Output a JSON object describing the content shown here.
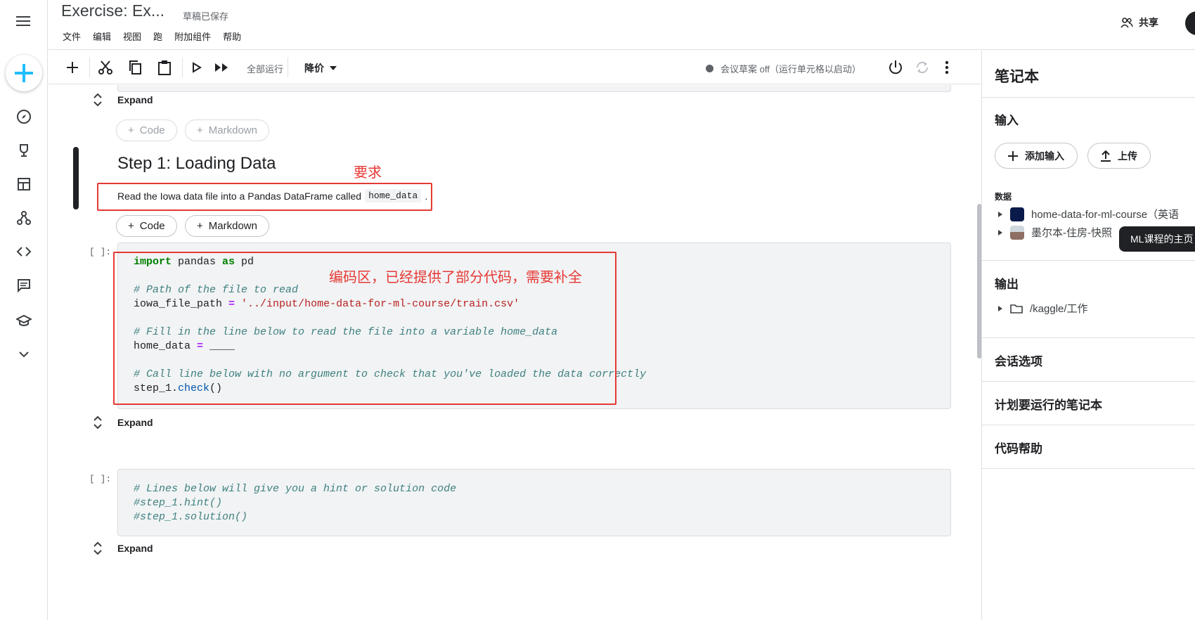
{
  "app": {
    "title": "Exercise: Ex...",
    "save_status": "草稿已保存",
    "menu": [
      "文件",
      "编辑",
      "视图",
      "跑",
      "附加组件",
      "帮助"
    ],
    "share_label": "共享"
  },
  "toolbar": {
    "run_all_label": "全部运行",
    "cell_type": "降价",
    "session_status": "会议草案 off（运行单元格以启动）"
  },
  "cells": {
    "expand_label": "Expand",
    "add_code": "Code",
    "add_markdown": "Markdown",
    "prompt": "[ ]:",
    "markdown": {
      "heading": "Step 1: Loading Data",
      "text": "Read the Iowa data file into a Pandas DataFrame called",
      "code": "home_data",
      "text_end": "."
    },
    "code1": {
      "import": "import",
      "pandas": " pandas ",
      "as": "as",
      "pd": " pd",
      "comment1": "# Path of the file to read",
      "path_var": "iowa_file_path ",
      "eq": "=",
      "path_str": " '../input/home-data-for-ml-course/train.csv'",
      "comment2": "# Fill in the line below to read the file into a variable home_data",
      "home_var": "home_data ",
      "blank": " ____",
      "comment3": "# Call line below with no argument to check that you've loaded the data correctly",
      "step": "step_1.",
      "check": "check",
      "parens": "()"
    },
    "code2": {
      "line1": "# Lines below will give you a hint or solution code",
      "line2": "#step_1.hint()",
      "line3": "#step_1.solution()"
    }
  },
  "annotations": {
    "requirement": "要求",
    "code_area": "编码区，已经提供了部分代码，需要补全"
  },
  "sidebar": {
    "title": "笔记本",
    "input_section": "输入",
    "add_input": "添加输入",
    "upload": "上传",
    "data_label": "数据",
    "data_items": [
      "home-data-for-ml-course（英语",
      "墨尔本-住房-快照"
    ],
    "output_section": "输出",
    "output_path": "/kaggle/工作",
    "session_options": "会话选项",
    "scheduled": "计划要运行的笔记本",
    "code_help": "代码帮助",
    "tooltip": "ML课程的主页"
  },
  "colors": {
    "accent": "#20beff",
    "annotation": "#e53935"
  }
}
